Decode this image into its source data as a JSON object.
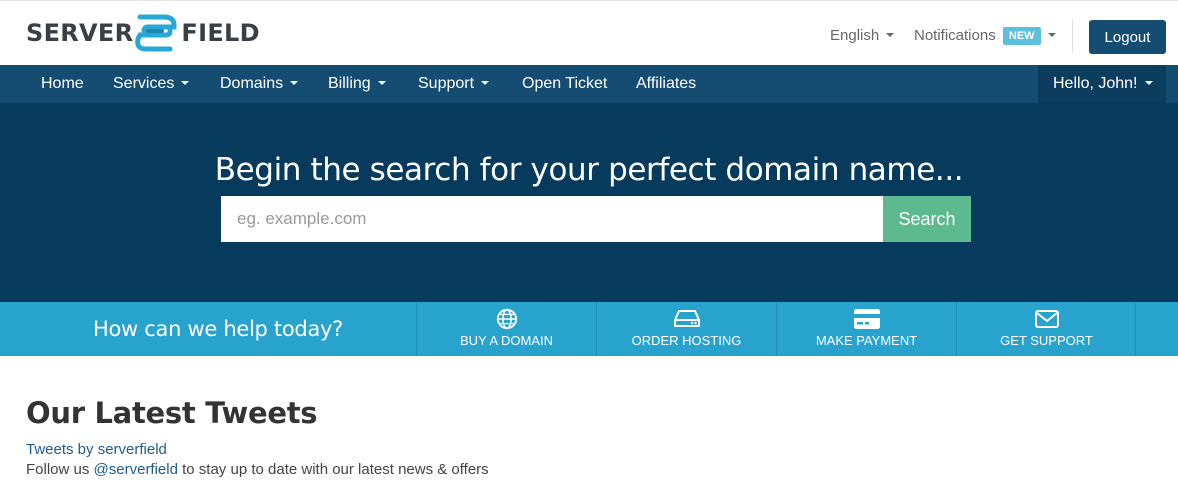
{
  "brand": {
    "name_left": "SERVER",
    "name_right": "FIELD",
    "logo_icon": "brand-swoosh-icon",
    "accent_color": "#29a7d6"
  },
  "header": {
    "language": "English",
    "notifications_label": "Notifications",
    "notifications_badge": "NEW",
    "logout_label": "Logout"
  },
  "nav": {
    "items": [
      {
        "label": "Home",
        "dropdown": false
      },
      {
        "label": "Services",
        "dropdown": true
      },
      {
        "label": "Domains",
        "dropdown": true
      },
      {
        "label": "Billing",
        "dropdown": true
      },
      {
        "label": "Support",
        "dropdown": true
      },
      {
        "label": "Open Ticket",
        "dropdown": false
      },
      {
        "label": "Affiliates",
        "dropdown": false
      }
    ],
    "user_greeting": "Hello, John!"
  },
  "hero": {
    "title": "Begin the search for your perfect domain name...",
    "search_placeholder": "eg. example.com",
    "search_button": "Search"
  },
  "help": {
    "prompt": "How can we help today?",
    "actions": [
      {
        "label": "BUY A DOMAIN",
        "icon": "globe-icon"
      },
      {
        "label": "ORDER HOSTING",
        "icon": "server-drive-icon"
      },
      {
        "label": "MAKE PAYMENT",
        "icon": "credit-card-icon"
      },
      {
        "label": "GET SUPPORT",
        "icon": "envelope-icon"
      }
    ]
  },
  "tweets": {
    "title": "Our Latest Tweets",
    "link_text": "Tweets by serverfield",
    "follow_prefix": "Follow us ",
    "follow_handle": "@serverfield",
    "follow_suffix": " to stay up to date with our latest news & offers"
  },
  "colors": {
    "nav_bg": "#144c72",
    "hero_bg": "#063b5e",
    "help_bg": "#27a3ce",
    "search_button": "#5cb990",
    "badge": "#5bc0de"
  }
}
